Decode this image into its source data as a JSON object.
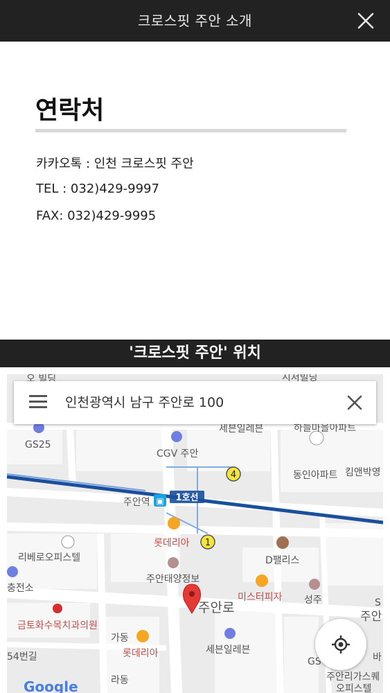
{
  "header": {
    "title": "크로스핏 주안 소개"
  },
  "contact": {
    "heading": "연락처",
    "kakao": "카카오톡 : 인천 크로스핏 주안",
    "tel": "TEL : 032)429-9997",
    "fax": "FAX: 032)429-9995"
  },
  "location": {
    "title": "'크로스핏 주안' 위치"
  },
  "map": {
    "search_query": "인천광역시 남구 주안로 100",
    "line_color": "#0d4fa0",
    "pin_color": "#e53935",
    "labels": {
      "gs25": "GS25",
      "cgv": "CGV 주안",
      "sebon_top": "세븐일레븐",
      "dongin": "동인아파트",
      "kimnet": "킴앤박영",
      "juan_station": "주안역",
      "line1": "1호선",
      "lotteria1": "롯데리아",
      "ribero": "리베로오피스텔",
      "dpalace": "D팰리스",
      "charging": "충전소",
      "juantae": "주안태양정보",
      "mister_pizza": "미스터피자",
      "seongju": "성주",
      "juanro": "주안로",
      "juan_right": "주안",
      "geumto": "금토화수목치과의원",
      "gadong": "가동",
      "lotteria2": "롯데리아",
      "sebon_bottom": "세븐일레븐",
      "beongil": "54번길",
      "radong": "라동",
      "juanri": "주안리가스퀘",
      "officetel": "오피스텔",
      "google": "Google",
      "badge4": "4",
      "badge1": "1",
      "right_s": "S",
      "right_ba": "바",
      "right_gs": "GS",
      "top_left_frag": "오 빌딩",
      "top_right_frag": "시저빌딩",
      "top_right_frag2": "하늘마을아파트"
    }
  }
}
